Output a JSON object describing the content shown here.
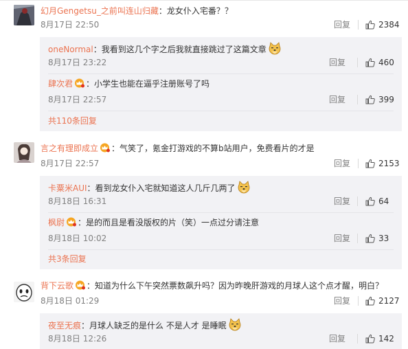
{
  "comments": [
    {
      "user": "幻月Gengetsu_之前叫连山归藏",
      "vip": false,
      "text": "：龙女仆入宅番？？",
      "time": "8月17日 22:50",
      "reply_label": "回复",
      "likes": "2384",
      "replies": [
        {
          "user": "oneNormal",
          "vip": false,
          "text": "：我看到这几个字之后我就直接跳过了这篇文章",
          "emoji": true,
          "time": "8月17日 23:22",
          "reply_label": "回复",
          "likes": "460"
        },
        {
          "user": "肆次君",
          "vip": true,
          "text": "：小学生也能在逼乎注册账号了吗",
          "emoji": false,
          "time": "8月17日 22:57",
          "reply_label": "回复",
          "likes": "399"
        }
      ],
      "more_label": "共110条回复"
    },
    {
      "user": "言之有理即成立",
      "vip": true,
      "text": "：气笑了，氪金打游戏的不算b站用户，免费看片的才是",
      "time": "8月17日 22:57",
      "reply_label": "回复",
      "likes": "2153",
      "replies": [
        {
          "user": "卡粟米AUI",
          "vip": false,
          "text": "：看到龙女仆入宅就知道这人几斤几两了",
          "emoji": true,
          "time": "8月18日 16:31",
          "reply_label": "回复",
          "likes": "64"
        },
        {
          "user": "枫尉",
          "vip": true,
          "text": "：是的而且是看没版权的片（笑）一点过分请注意",
          "emoji": false,
          "time": "8月18日 10:02",
          "reply_label": "回复",
          "likes": "33"
        }
      ],
      "more_label": "共3条回复"
    },
    {
      "user": "背下云歌",
      "vip": true,
      "text": "：知道为什么下午突然票数飙升吗？因为昨晚肝游戏的月球人这个点才醒，明白？",
      "time": "8月18日 01:29",
      "reply_label": "回复",
      "likes": "2127",
      "replies": [
        {
          "user": "夜至无痕",
          "vip": false,
          "text": "：月球人缺乏的是什么 不是人才 是睡眠",
          "emoji": true,
          "time": "8月18日 12:26",
          "reply_label": "回复",
          "likes": "142"
        }
      ],
      "more_label": ""
    }
  ],
  "colors": {
    "username": "#eb7350",
    "reply_box_bg": "#f2f2f5",
    "meta_text": "#808080",
    "body_text": "#333333"
  },
  "icons": {
    "like": "thumbs-up-icon",
    "vip": "vip-crown-icon",
    "emoji": "doge-emoji-icon"
  }
}
